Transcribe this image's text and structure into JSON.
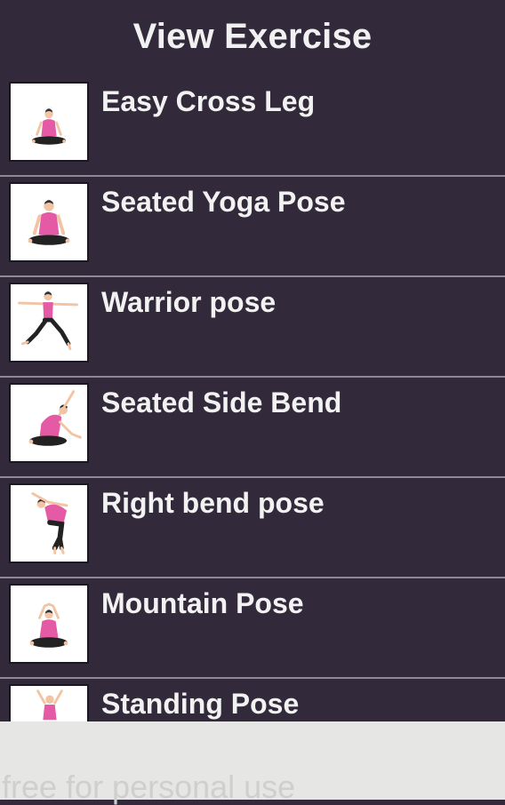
{
  "header": {
    "title": "View Exercise"
  },
  "exercises": [
    {
      "label": "Easy Cross Leg",
      "icon": "easy-cross-leg-figure"
    },
    {
      "label": "Seated Yoga Pose",
      "icon": "seated-yoga-figure"
    },
    {
      "label": "Warrior pose",
      "icon": "warrior-figure"
    },
    {
      "label": "Seated Side Bend",
      "icon": "seated-side-bend-figure"
    },
    {
      "label": "Right bend pose",
      "icon": "right-bend-figure"
    },
    {
      "label": "Mountain Pose",
      "icon": "mountain-figure"
    },
    {
      "label": "Standing Pose",
      "icon": "standing-figure"
    }
  ],
  "ad": {
    "text": "free for personal use"
  },
  "colors": {
    "background": "#322a3b",
    "top_pink": "#e45aa5",
    "skin": "#f2c4a3",
    "pants": "#222222",
    "ad_bar": "#e6e6e5"
  }
}
